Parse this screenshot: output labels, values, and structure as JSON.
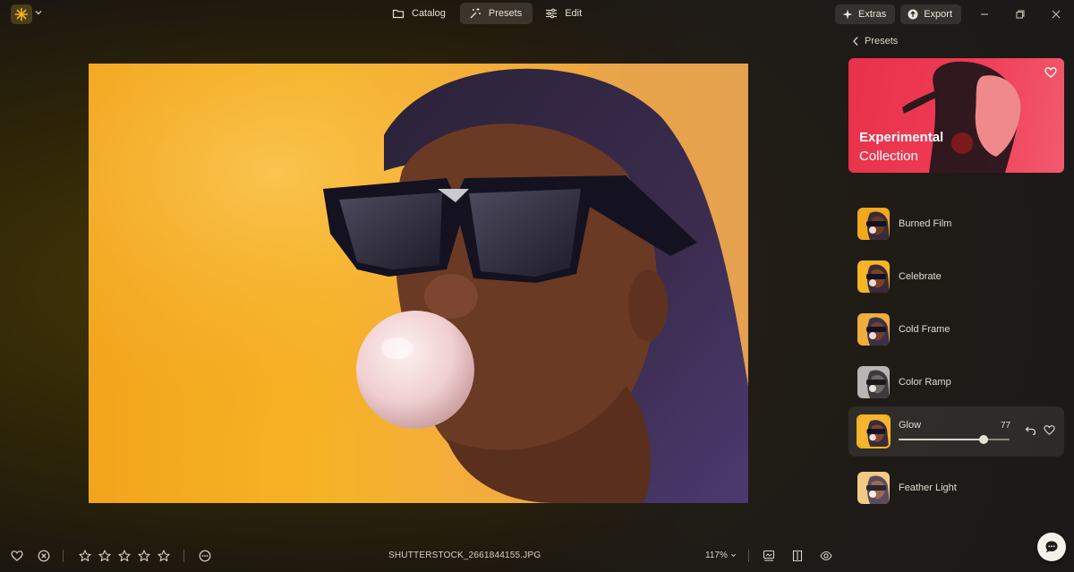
{
  "app": {
    "accent_color": "#f2b51c",
    "logo_icon": "sun-logo-icon"
  },
  "nav": {
    "tabs": [
      {
        "label": "Catalog",
        "icon": "folder-icon",
        "active": false
      },
      {
        "label": "Presets",
        "icon": "magic-wand-icon",
        "active": true
      },
      {
        "label": "Edit",
        "icon": "sliders-icon",
        "active": false
      }
    ]
  },
  "toolbar": {
    "extras_label": "Extras",
    "export_label": "Export"
  },
  "panel": {
    "back_label": "Presets",
    "banner": {
      "title": "Experimental",
      "subtitle": "Collection",
      "color": "#ec3550"
    },
    "presets": [
      {
        "name": "Burned Film",
        "tone": "warm",
        "active": false
      },
      {
        "name": "Celebrate",
        "tone": "warm",
        "active": false
      },
      {
        "name": "Cold Frame",
        "tone": "warm",
        "active": false
      },
      {
        "name": "Color Ramp",
        "tone": "gray",
        "active": false
      },
      {
        "name": "Glow",
        "tone": "warm",
        "active": true,
        "amount": 77
      },
      {
        "name": "Feather Light",
        "tone": "light",
        "active": false
      }
    ]
  },
  "statusbar": {
    "filename": "SHUTTERSTOCK_2661844155.JPG",
    "zoom": "117%",
    "rating": 0,
    "max_rating": 5
  }
}
